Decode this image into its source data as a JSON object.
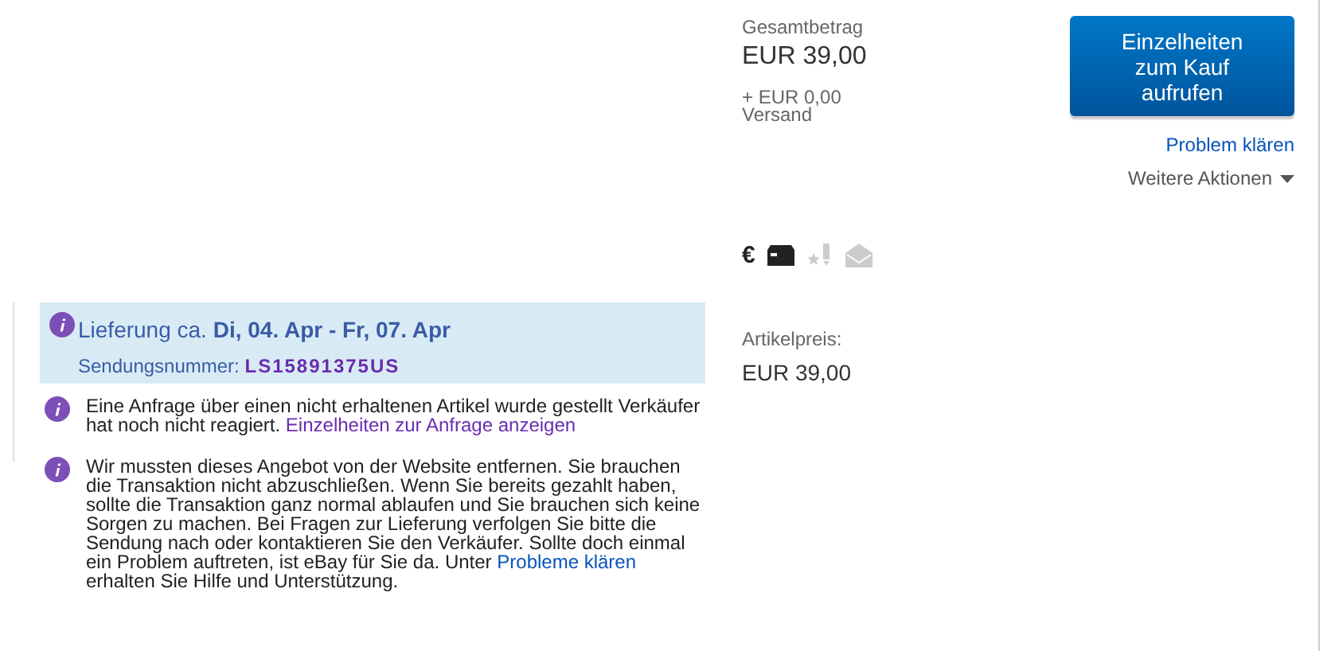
{
  "summary": {
    "total_label": "Gesamtbetrag",
    "total": "EUR 39,00",
    "shipping_amount": "+ EUR 0,00",
    "shipping_label": "Versand",
    "status_icons": [
      {
        "kind": "euro",
        "glyph": "€",
        "on": true
      },
      {
        "kind": "box",
        "on": true
      },
      {
        "kind": "feedback",
        "on": false
      },
      {
        "kind": "mail",
        "on": false
      }
    ]
  },
  "actions": {
    "primary_button": "Einzelheiten zum Kauf aufrufen",
    "problem_link": "Problem klären",
    "more_menu": "Weitere Aktionen"
  },
  "delivery": {
    "label": "Lieferung ca.",
    "dates": "Di, 04. Apr - Fr, 07. Apr",
    "tracking_label": "Sendungsnummer:",
    "tracking_number": "LS15891375US"
  },
  "notices": [
    {
      "text": "Eine Anfrage über einen nicht erhaltenen Artikel wurde gestellt Verkäufer hat noch nicht reagiert.",
      "link": "Einzelheiten zur Anfrage anzeigen"
    },
    {
      "text": "Wir mussten dieses Angebot von der Website entfernen. Sie brauchen die Transaktion nicht abzuschließen. Wenn Sie bereits gezahlt haben, sollte die Transaktion ganz normal ablaufen und Sie brauchen sich keine Sorgen zu machen. Bei Fragen zur Lieferung verfolgen Sie bitte die Sendung nach oder kontaktieren Sie den Verkäufer. Sollte doch einmal ein Problem auftreten, ist eBay für Sie da. Unter",
      "link": "Probleme klären",
      "after": "erhalten Sie Hilfe und Unterstützung."
    }
  ],
  "item_price": {
    "label": "Artikelpreis:",
    "value": "EUR 39,00"
  }
}
